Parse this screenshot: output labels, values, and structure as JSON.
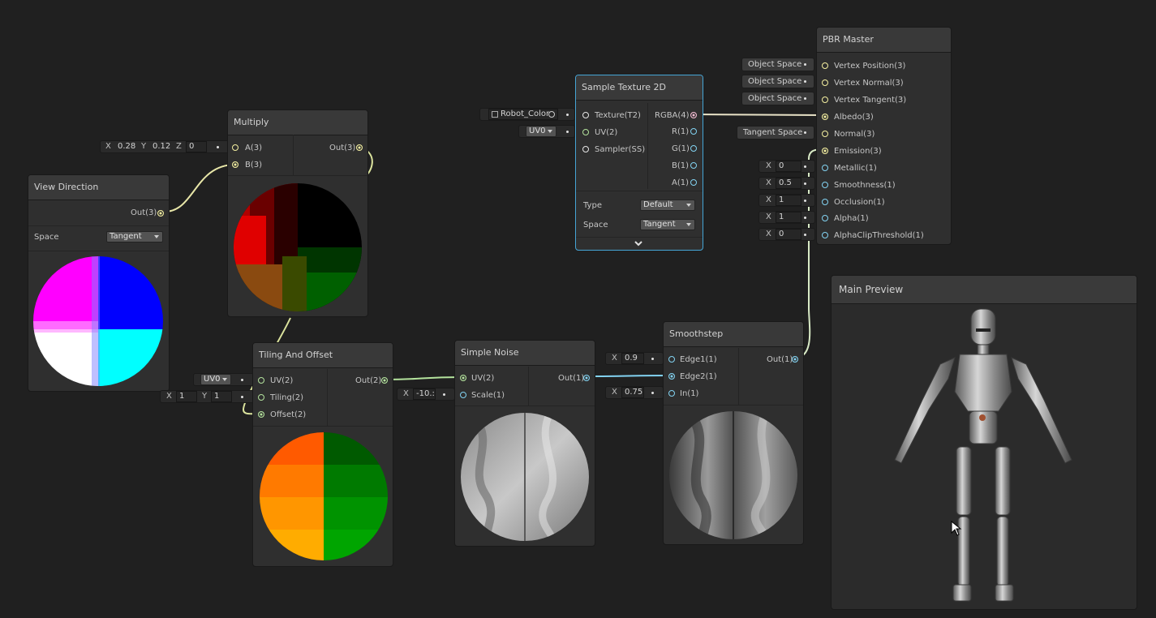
{
  "nodes": {
    "view_direction": {
      "title": "View Direction",
      "out": "Out(3)",
      "space_label": "Space",
      "space_value": "Tangent"
    },
    "multiply": {
      "title": "Multiply",
      "in_a": "A(3)",
      "in_b": "B(3)",
      "out": "Out(3)",
      "a_x": "0.28",
      "a_y": "0.12",
      "a_z": "0"
    },
    "sample_texture": {
      "title": "Sample Texture 2D",
      "texture": "Texture(T2)",
      "uv": "UV(2)",
      "sampler": "Sampler(SS)",
      "rgba": "RGBA(4)",
      "r": "R(1)",
      "g": "G(1)",
      "b": "B(1)",
      "a": "A(1)",
      "type_label": "Type",
      "type_value": "Default",
      "space_label": "Space",
      "space_value": "Tangent",
      "texture_field": "Robot_Color",
      "uv_field": "UV0"
    },
    "tiling": {
      "title": "Tiling And Offset",
      "uv": "UV(2)",
      "tiling": "Tiling(2)",
      "offset": "Offset(2)",
      "out": "Out(2)",
      "uv_field": "UV0",
      "tiling_x": "1",
      "tiling_y": "1"
    },
    "noise": {
      "title": "Simple Noise",
      "uv": "UV(2)",
      "scale": "Scale(1)",
      "out": "Out(1)",
      "scale_value": "-10.:"
    },
    "smoothstep": {
      "title": "Smoothstep",
      "edge1": "Edge1(1)",
      "edge2": "Edge2(1)",
      "in": "In(1)",
      "out": "Out(1)",
      "edge1_value": "0.9",
      "in_value": "0.75"
    },
    "pbr": {
      "title": "PBR Master",
      "ports": [
        "Vertex Position(3)",
        "Vertex Normal(3)",
        "Vertex Tangent(3)",
        "Albedo(3)",
        "Normal(3)",
        "Emission(3)",
        "Metallic(1)",
        "Smoothness(1)",
        "Occlusion(1)",
        "Alpha(1)",
        "AlphaClipThreshold(1)"
      ],
      "space_tags": [
        "Object Space",
        "Object Space",
        "Object Space",
        "Tangent Space"
      ],
      "values": [
        "0",
        "0.5",
        "1",
        "1",
        "0"
      ]
    }
  },
  "axis_labels": {
    "x": "X",
    "y": "Y",
    "z": "Z"
  },
  "main_preview": {
    "title": "Main Preview"
  }
}
